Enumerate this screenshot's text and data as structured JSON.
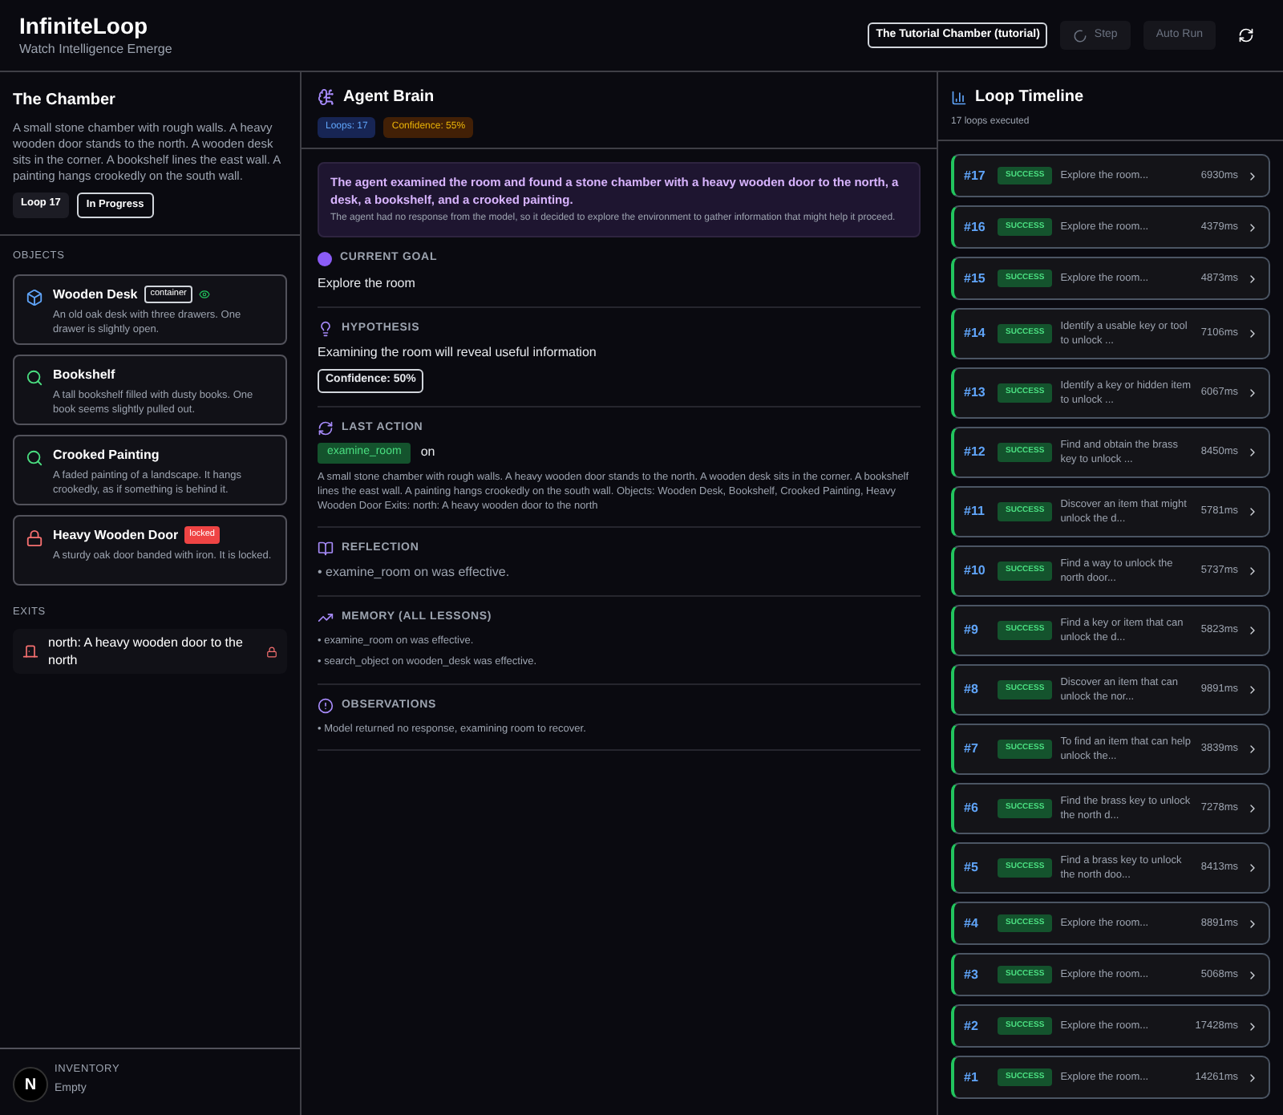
{
  "app": {
    "title": "InfiniteLoop",
    "subtitle": "Watch Intelligence Emerge"
  },
  "toolbar": {
    "scenario": "The Tutorial Chamber (tutorial)",
    "buttons": [
      {
        "label": "Step",
        "kind": "spinner",
        "disabled": true
      },
      {
        "label": "Auto Run",
        "kind": "plain",
        "disabled": true
      }
    ]
  },
  "chamber": {
    "title": "The Chamber",
    "description": "A small stone chamber with rough walls. A heavy wooden door stands to the north. A wooden desk sits in the corner. A bookshelf lines the east wall. A painting hangs crookedly on the south wall.",
    "badges": [
      {
        "text": "Loop 17",
        "kind": "filled"
      },
      {
        "text": "In Progress",
        "kind": "outline"
      }
    ],
    "objects_heading": "OBJECTS",
    "objects": [
      {
        "name": "Wooden Desk",
        "kind": "container",
        "tag": "container",
        "description": "An old oak desk with three drawers. One drawer is slightly open."
      },
      {
        "name": "Bookshelf",
        "kind": "searchable",
        "description": "A tall bookshelf filled with dusty books. One book seems slightly pulled out."
      },
      {
        "name": "Crooked Painting",
        "kind": "searchable",
        "description": "A faded painting of a landscape. It hangs crookedly, as if something is behind it."
      },
      {
        "name": "Heavy Wooden Door",
        "kind": "locked",
        "tag": "locked",
        "description": "A sturdy oak door banded with iron. It is locked."
      }
    ],
    "exits_heading": "EXITS",
    "exits": [
      {
        "text": "north: A heavy wooden door to the north",
        "locked": true
      }
    ],
    "inventory_heading": "INVENTORY",
    "inventory_empty": "Empty"
  },
  "brain": {
    "title": "Agent Brain",
    "badges": [
      {
        "text": "Loops: 17",
        "kind": "info"
      },
      {
        "text": "Confidence: 55%",
        "kind": "warning"
      }
    ],
    "thought": {
      "headline": "The agent examined the room and found a stone chamber with a heavy wooden door to the north, a desk, a bookshelf, and a crooked painting.",
      "detail": "The agent had no response from the model, so it decided to explore the environment to gather information that might help it proceed."
    },
    "sections": [
      {
        "kind": "goal",
        "heading": "CURRENT GOAL",
        "text": "Explore the room"
      },
      {
        "kind": "hypothesis",
        "heading": "HYPOTHESIS",
        "text": "Examining the room will reveal useful information",
        "confidence": "Confidence: 50%"
      },
      {
        "kind": "action",
        "heading": "LAST ACTION",
        "action": "examine_room",
        "target": "on",
        "result": "A small stone chamber with rough walls. A heavy wooden door stands to the north. A wooden desk sits in the corner. A bookshelf lines the east wall. A painting hangs crookedly on the south wall. Objects: Wooden Desk, Bookshelf, Crooked Painting, Heavy Wooden Door Exits: north: A heavy wooden door to the north"
      },
      {
        "kind": "reflection",
        "heading": "REFLECTION",
        "lines": [
          "• examine_room on was effective."
        ]
      },
      {
        "kind": "memory",
        "heading": "MEMORY (ALL LESSONS)",
        "lines": [
          "• examine_room on was effective.",
          "• search_object on wooden_desk was effective."
        ]
      },
      {
        "kind": "observations",
        "heading": "OBSERVATIONS",
        "lines": [
          "• Model returned no response, examining room to recover."
        ]
      }
    ]
  },
  "timeline": {
    "title": "Loop Timeline",
    "count": "17 loops executed",
    "loops": [
      {
        "number": "#17",
        "status": "SUCCESS",
        "goal": "Explore the room...",
        "time": "6930ms"
      },
      {
        "number": "#16",
        "status": "SUCCESS",
        "goal": "Explore the room...",
        "time": "4379ms"
      },
      {
        "number": "#15",
        "status": "SUCCESS",
        "goal": "Explore the room...",
        "time": "4873ms"
      },
      {
        "number": "#14",
        "status": "SUCCESS",
        "goal": "Identify a usable key or tool to unlock ...",
        "time": "7106ms"
      },
      {
        "number": "#13",
        "status": "SUCCESS",
        "goal": "Identify a key or hidden item to unlock ...",
        "time": "6067ms"
      },
      {
        "number": "#12",
        "status": "SUCCESS",
        "goal": "Find and obtain the brass key to unlock ...",
        "time": "8450ms"
      },
      {
        "number": "#11",
        "status": "SUCCESS",
        "goal": "Discover an item that might unlock the d...",
        "time": "5781ms"
      },
      {
        "number": "#10",
        "status": "SUCCESS",
        "goal": "Find a way to unlock the north door...",
        "time": "5737ms"
      },
      {
        "number": "#9",
        "status": "SUCCESS",
        "goal": "Find a key or item that can unlock the d...",
        "time": "5823ms"
      },
      {
        "number": "#8",
        "status": "SUCCESS",
        "goal": "Discover an item that can unlock the nor...",
        "time": "9891ms"
      },
      {
        "number": "#7",
        "status": "SUCCESS",
        "goal": "To find an item that can help unlock the...",
        "time": "3839ms"
      },
      {
        "number": "#6",
        "status": "SUCCESS",
        "goal": "Find the brass key to unlock the north d...",
        "time": "7278ms"
      },
      {
        "number": "#5",
        "status": "SUCCESS",
        "goal": "Find a brass key to unlock the north doo...",
        "time": "8413ms"
      },
      {
        "number": "#4",
        "status": "SUCCESS",
        "goal": "Explore the room...",
        "time": "8891ms"
      },
      {
        "number": "#3",
        "status": "SUCCESS",
        "goal": "Explore the room...",
        "time": "5068ms"
      },
      {
        "number": "#2",
        "status": "SUCCESS",
        "goal": "Explore the room...",
        "time": "17428ms"
      },
      {
        "number": "#1",
        "status": "SUCCESS",
        "goal": "Explore the room...",
        "time": "14261ms"
      }
    ]
  },
  "dev_badge": {
    "letter": "N"
  }
}
